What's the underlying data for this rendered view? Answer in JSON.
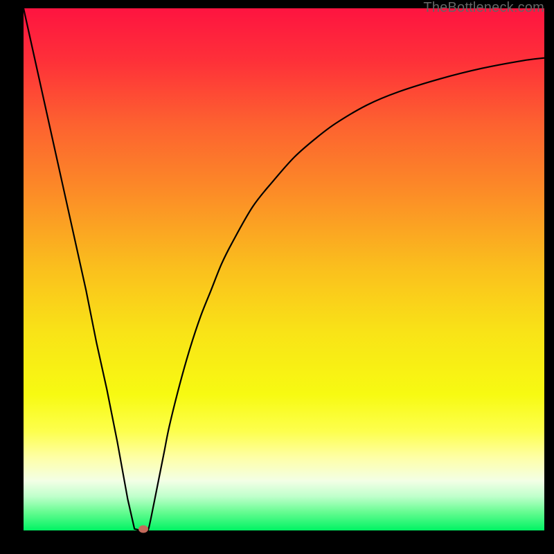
{
  "watermark": "TheBottleneck.com",
  "colors": {
    "frame": "#000000",
    "curve": "#000000",
    "marker": "#c56a5b",
    "gradient_stops": [
      {
        "stop": 0.0,
        "color": "#fe1440"
      },
      {
        "stop": 0.1,
        "color": "#fe3039"
      },
      {
        "stop": 0.22,
        "color": "#fd6130"
      },
      {
        "stop": 0.35,
        "color": "#fc8b27"
      },
      {
        "stop": 0.5,
        "color": "#fac01d"
      },
      {
        "stop": 0.62,
        "color": "#f9e317"
      },
      {
        "stop": 0.74,
        "color": "#f7fa12"
      },
      {
        "stop": 0.81,
        "color": "#fdff4d"
      },
      {
        "stop": 0.86,
        "color": "#feffa6"
      },
      {
        "stop": 0.905,
        "color": "#f3ffe6"
      },
      {
        "stop": 0.935,
        "color": "#bfffcb"
      },
      {
        "stop": 0.965,
        "color": "#66fc91"
      },
      {
        "stop": 1.0,
        "color": "#00f363"
      }
    ]
  },
  "chart_data": {
    "type": "line",
    "title": "",
    "xlabel": "",
    "ylabel": "",
    "xlim": [
      0,
      100
    ],
    "ylim": [
      0,
      100
    ],
    "grid": false,
    "legend": false,
    "series": [
      {
        "name": "bottleneck-curve",
        "x": [
          0,
          2,
          4,
          6,
          8,
          10,
          12,
          14,
          16,
          18,
          20,
          21.3,
          22.5,
          23.5,
          24,
          25,
          26,
          27,
          28,
          30,
          32,
          34,
          36,
          38,
          40,
          44,
          48,
          52,
          56,
          60,
          66,
          72,
          80,
          88,
          96,
          100
        ],
        "y": [
          100,
          91,
          82,
          73,
          64,
          55,
          46,
          36,
          27,
          17,
          6,
          0.3,
          0.0,
          0.0,
          0.3,
          5,
          10,
          15,
          20,
          28,
          35,
          41,
          46,
          51,
          55,
          62,
          67,
          71.5,
          75,
          78,
          81.5,
          84,
          86.5,
          88.5,
          90,
          90.5
        ]
      }
    ],
    "marker": {
      "x": 23.0,
      "y": 0.3
    }
  }
}
